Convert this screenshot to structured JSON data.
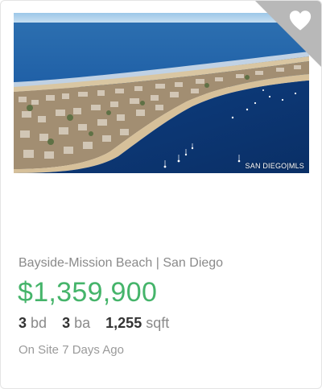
{
  "listing": {
    "photo_watermark": "SAN DIEGO|MLS",
    "favorite_icon": "heart-icon",
    "address": "Bayside-Mission Beach | San Diego",
    "price": "$1,359,900",
    "beds": "3",
    "beds_unit": "bd",
    "baths": "3",
    "baths_unit": "ba",
    "sqft": "1,255",
    "sqft_unit": "sqft",
    "on_site": "On Site 7 Days Ago"
  },
  "colors": {
    "price": "#45b46a",
    "corner_badge": "#b8b8b8",
    "muted_text": "#8a8a8a"
  }
}
